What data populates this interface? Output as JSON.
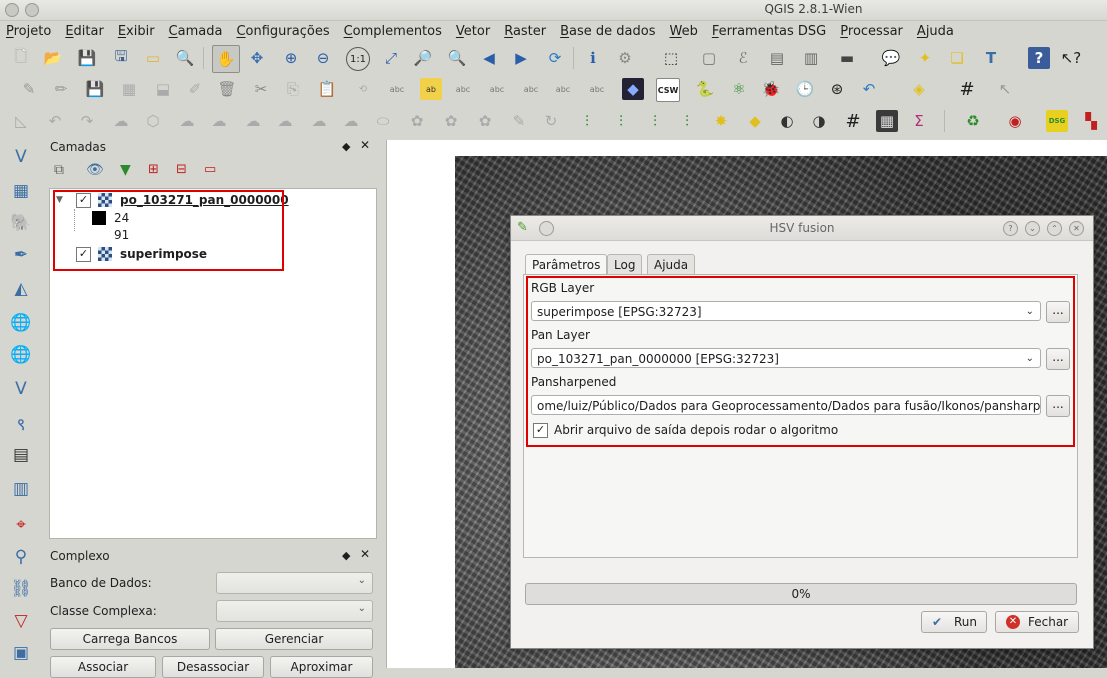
{
  "window": {
    "title": "QGIS 2.8.1-Wien"
  },
  "menu": [
    "Projeto",
    "Editar",
    "Exibir",
    "Camada",
    "Configurações",
    "Complementos",
    "Vetor",
    "Raster",
    "Base de dados",
    "Web",
    "Ferramentas DSG",
    "Processar",
    "Ajuda"
  ],
  "layers_panel": {
    "title": "Camadas",
    "layers": [
      {
        "name": "po_103271_pan_0000000",
        "checked": true,
        "legend": [
          "24",
          "91"
        ]
      },
      {
        "name": "superimpose",
        "checked": true
      }
    ]
  },
  "complex_panel": {
    "title": "Complexo",
    "db_label": "Banco de Dados:",
    "class_label": "Classe Complexa:",
    "buttons": [
      "Carrega Bancos",
      "Gerenciar",
      "Associar",
      "Desassociar",
      "Aproximar"
    ]
  },
  "dialog": {
    "title": "HSV fusion",
    "tabs": [
      "Parâmetros",
      "Log",
      "Ajuda"
    ],
    "active_tab": "Parâmetros",
    "rgb_label": "RGB Layer",
    "rgb_value": "superimpose [EPSG:32723]",
    "pan_label": "Pan Layer",
    "pan_value": "po_103271_pan_0000000 [EPSG:32723]",
    "out_label": "Pansharpened",
    "out_value": "ome/luiz/Público/Dados para Geoprocessamento/Dados para fusão/Ikonos/pansharpened.tif",
    "browse_label": "...",
    "open_output_label": "Abrir arquivo de saída depois rodar o algoritmo",
    "open_output_checked": true,
    "progress": "0%",
    "run_label": "Run",
    "close_label": "Fechar"
  },
  "colors": {
    "highlight": "#e00000",
    "run_icon": "#3a6ea5",
    "close_icon": "#d0302a"
  }
}
